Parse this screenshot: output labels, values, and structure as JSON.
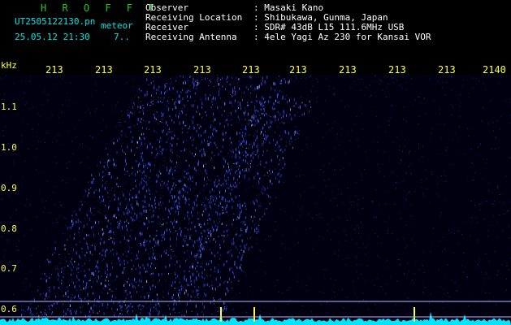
{
  "header": {
    "app": "H R O F F T",
    "file": "UT2505122130.pn",
    "file_tag": "meteor",
    "datetime": "25.05.12 21:30",
    "count": "7..",
    "fields": [
      {
        "label": "Observer",
        "value": ": Masaki Kano"
      },
      {
        "label": "Receiving Location",
        "value": ": Shibukawa, Gunma, Japan"
      },
      {
        "label": "Receiver",
        "value": ": SDR# 43dB L15 111.6MHz USB"
      },
      {
        "label": "Receiving Antenna",
        "value": ": 4ele Yagi Az 230 for Kansai VOR"
      }
    ]
  },
  "axes": {
    "y_unit": "kHz",
    "y_ticks": [
      "1.1",
      "1.0",
      "0.9",
      "0.8",
      "0.7",
      "0.6"
    ],
    "x_ticks": [
      "213",
      "213",
      "213",
      "213",
      "213",
      "213",
      "213",
      "213",
      "213",
      "2140"
    ]
  },
  "colors": {
    "signal": "#3a5cff",
    "trace": "#00e5ff",
    "marker": "#ffff40",
    "line": "#b8b8ff"
  }
}
